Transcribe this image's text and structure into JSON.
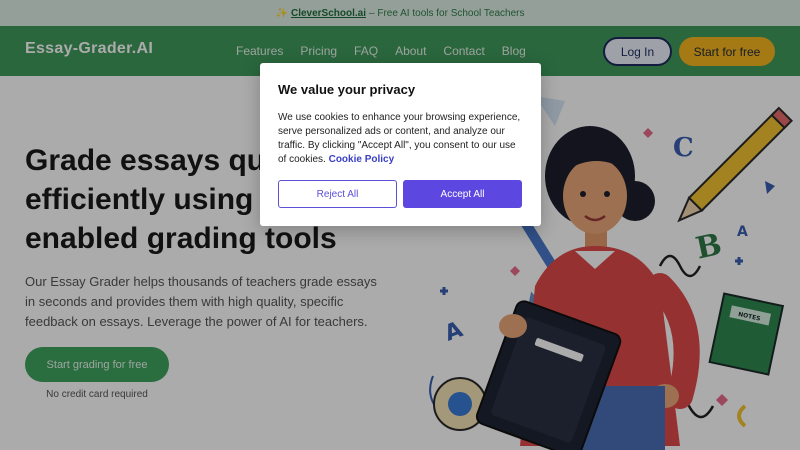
{
  "announcement": {
    "prefix_icon": "✨",
    "link": "CleverSchool.ai",
    "text": "– Free AI tools for School Teachers"
  },
  "nav": {
    "logo": "Essay-Grader.AI",
    "links": [
      "Features",
      "Pricing",
      "FAQ",
      "About",
      "Contact",
      "Blog"
    ],
    "login": "Log In",
    "start": "Start for free"
  },
  "hero": {
    "headline_lines": [
      "Grade essays quic",
      "efficiently using o",
      "enabled grading tools"
    ],
    "description": "Our Essay Grader helps thousands of teachers grade essays in seconds and provides them with high quality, specific feedback on essays. Leverage the power of AI for teachers.",
    "cta": "Start grading for free",
    "note": "No credit card required"
  },
  "illustration": {
    "letters": [
      "C",
      "B",
      "A",
      "A"
    ],
    "book_label": "NOTES"
  },
  "cookie_modal": {
    "title": "We value your privacy",
    "body": "We use cookies to enhance your browsing experience, serve personalized ads or content, and analyze our traffic. By clicking \"Accept All\", you consent to our use of cookies.",
    "policy_link": "Cookie Policy",
    "reject": "Reject All",
    "accept": "Accept All"
  },
  "colors": {
    "nav_green": "#3f9a5c",
    "cta_yellow": "#f6b51e",
    "accept_purple": "#5c47e0"
  }
}
